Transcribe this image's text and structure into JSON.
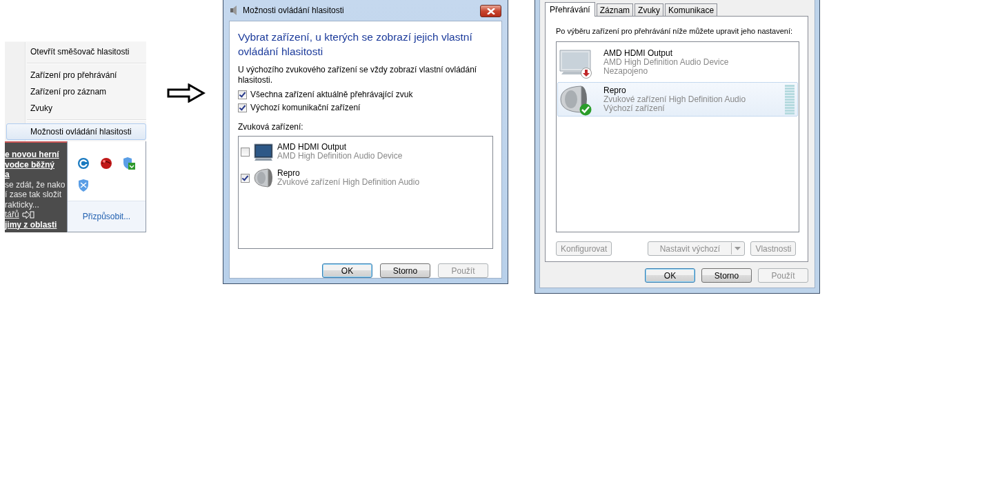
{
  "context_menu": {
    "items": [
      {
        "kind": "item",
        "label": "Otevřít směšovač hlasitosti",
        "selected": false
      },
      {
        "kind": "separator"
      },
      {
        "kind": "item",
        "label": "Zařízení pro přehrávání",
        "selected": false
      },
      {
        "kind": "item",
        "label": "Zařízení pro záznam",
        "selected": false
      },
      {
        "kind": "item",
        "label": "Zvuky",
        "selected": false
      },
      {
        "kind": "separator"
      },
      {
        "kind": "item",
        "label": "Možnosti ovládání hlasitosti",
        "selected": true
      }
    ]
  },
  "web_fragment": {
    "lines": [
      {
        "kind": "heading",
        "text": "e novou herní"
      },
      {
        "kind": "heading",
        "text": "vodce běžný"
      },
      {
        "kind": "heading",
        "text": "a"
      },
      {
        "kind": "body",
        "text": "se zdát, že nako"
      },
      {
        "kind": "body",
        "text": "í zase tak složit"
      },
      {
        "kind": "body",
        "text": "rakticky..."
      },
      {
        "kind": "comments",
        "text": "tářů"
      },
      {
        "kind": "heading",
        "text": "jimy z oblasti"
      }
    ]
  },
  "tray_popup": {
    "link": "Přizpůsobit..."
  },
  "volume_options_dialog": {
    "title": "Možnosti ovládání hlasitosti",
    "heading": "Vybrat zařízení, u kterých se zobrazí jejich vlastní ovládání hlasitosti",
    "description": "U výchozího zvukového zařízení se vždy zobrazí vlastní ovládání hlasitosti.",
    "options": [
      {
        "label": "Všechna zařízení aktuálně přehrávající zvuk",
        "checked": true
      },
      {
        "label": "Výchozí komunikační zařízení",
        "checked": true
      }
    ],
    "devices_label": "Zvuková zařízení:",
    "devices": [
      {
        "kind": "display",
        "name": "AMD HDMI Output",
        "description": "AMD High Definition Audio Device",
        "checked": false
      },
      {
        "kind": "speaker",
        "name": "Repro",
        "description": "Zvukové zařízení High Definition Audio",
        "checked": true
      }
    ],
    "buttons": [
      {
        "label": "OK",
        "default": true,
        "disabled": false
      },
      {
        "label": "Storno",
        "default": false,
        "disabled": false
      },
      {
        "label": "Použít",
        "default": false,
        "disabled": true
      }
    ]
  },
  "sound_dialog": {
    "tabs": [
      {
        "label": "Přehrávání",
        "selected": true
      },
      {
        "label": "Záznam",
        "selected": false
      },
      {
        "label": "Zvuky",
        "selected": false
      },
      {
        "label": "Komunikace",
        "selected": false
      }
    ],
    "instruction": "Po výběru zařízení pro přehrávání níže můžete upravit jeho nastavení:",
    "devices": [
      {
        "kind": "display",
        "unplugged": true,
        "default_device": false,
        "name": "AMD HDMI Output",
        "description": "AMD High Definition Audio Device",
        "status": "Nezapojeno",
        "selected": false
      },
      {
        "kind": "speaker",
        "unplugged": false,
        "default_device": true,
        "name": "Repro",
        "description": "Zvukové zařízení High Definition Audio",
        "status": "Výchozí zařízení",
        "selected": true,
        "level": 0
      }
    ],
    "device_buttons": [
      {
        "label": "Konfigurovat",
        "kind": "plain",
        "disabled": true
      },
      {
        "label": "Nastavit výchozí",
        "kind": "split",
        "disabled": true
      },
      {
        "label": "Vlastnosti",
        "kind": "plain",
        "disabled": true
      }
    ],
    "buttons": [
      {
        "label": "OK",
        "default": true,
        "disabled": false
      },
      {
        "label": "Storno",
        "default": false,
        "disabled": false
      },
      {
        "label": "Použít",
        "default": false,
        "disabled": true
      }
    ]
  }
}
